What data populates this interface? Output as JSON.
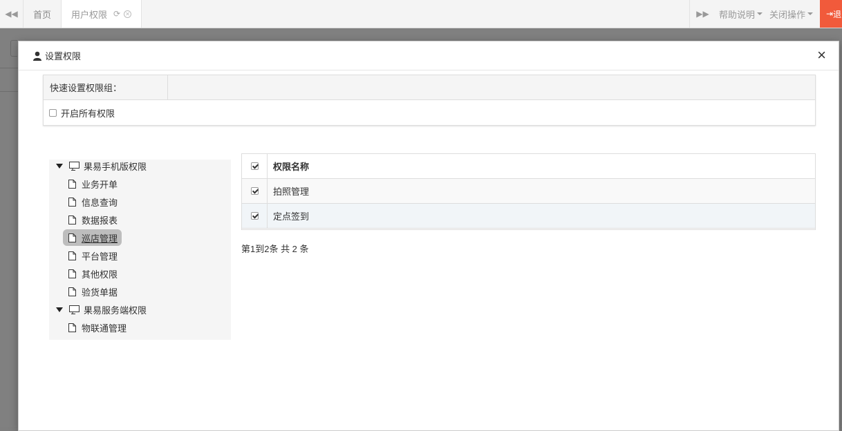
{
  "topbar": {
    "tabs": [
      {
        "label": "首页"
      },
      {
        "label": "用户权限"
      }
    ],
    "help_label": "帮助说明",
    "close_ops_label": "关闭操作",
    "exit_label": "退"
  },
  "modal": {
    "title": "设置权限",
    "close_symbol": "×",
    "quick": {
      "label": "快速设置权限组：",
      "enable_all_label": "开启所有权限",
      "enable_all_checked": false
    },
    "tree": {
      "groups": [
        {
          "label": "果易手机版权限",
          "children": [
            "业务开单",
            "信息查询",
            "数据报表",
            "巡店管理",
            "平台管理",
            "其他权限",
            "验货单据"
          ]
        },
        {
          "label": "果易服务端权限",
          "children": [
            "物联通管理"
          ]
        }
      ],
      "selected": "巡店管理"
    },
    "table": {
      "header": "权限名称",
      "rows": [
        "拍照管理",
        "定点签到"
      ]
    },
    "pagination": "第1到2条 共 2 条"
  }
}
